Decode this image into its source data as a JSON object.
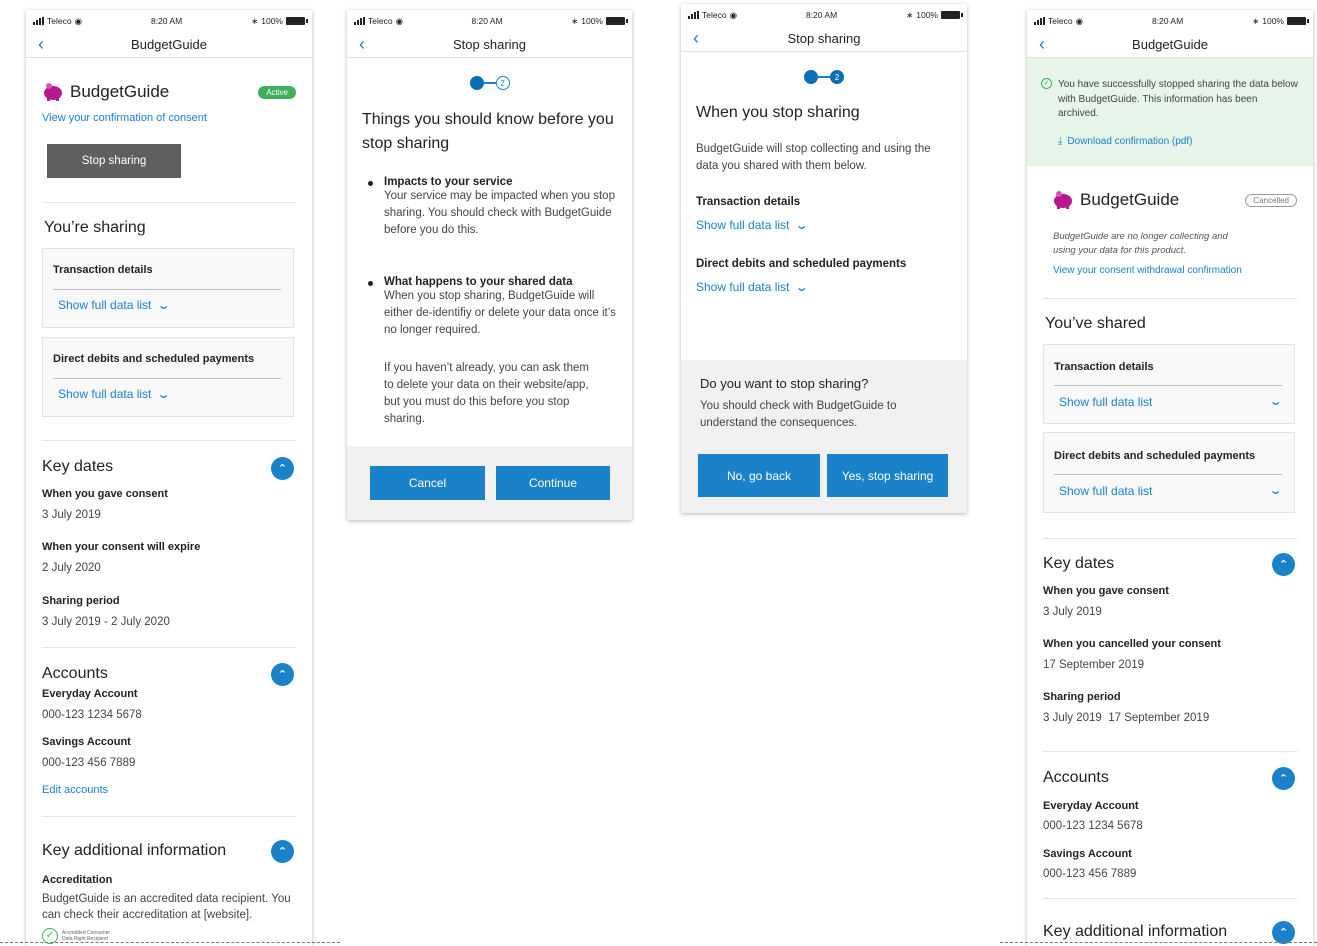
{
  "status": {
    "carrier": "Teleco",
    "time": "8:20 AM",
    "battery": "100%"
  },
  "brand": {
    "name": "BudgetGuide"
  },
  "colors": {
    "accent": "#1a82c8",
    "success": "#3fae5d",
    "banner": "#e6f4ea",
    "brand_pink": "#b5198f"
  },
  "screen1": {
    "nav_title": "BudgetGuide",
    "badge": "Active",
    "consent_link": "View your confirmation of consent",
    "stop_button": "Stop sharing",
    "sharing_title": "You’re sharing",
    "items": [
      {
        "title": "Transaction details",
        "link": "Show full data list"
      },
      {
        "title": "Direct debits and scheduled payments",
        "link": "Show full data list"
      }
    ],
    "key_dates": {
      "title": "Key dates",
      "rows": [
        {
          "label": "When you gave consent",
          "value": "3 July 2019"
        },
        {
          "label": "When your consent will expire",
          "value": "2 July 2020"
        },
        {
          "label": "Sharing period",
          "value": "3 July 2019 - 2 July 2020"
        }
      ]
    },
    "accounts": {
      "title": "Accounts",
      "rows": [
        {
          "label": "Everyday Account",
          "value": "000-123 1234 5678"
        },
        {
          "label": "Savings Account",
          "value": "000-123 456 7889"
        }
      ],
      "edit_link": "Edit accounts"
    },
    "additional": {
      "title": "Key additional information",
      "label": "Accreditation",
      "text": "BudgetGuide is an accredited data recipient. You can check their accreditation at [website].",
      "seal_text": "Accredited Consumer Data Right Recipient"
    }
  },
  "screen2": {
    "nav_title": "Stop sharing",
    "step1": "1",
    "step2": "2",
    "heading": "Things you should know before you stop sharing",
    "bullets": [
      {
        "title": "Impacts to your service",
        "text": "Your service may be impacted when you stop sharing. You should check with BudgetGuide before you do this."
      },
      {
        "title": "What happens to your shared data",
        "text": "When you stop sharing, BudgetGuide will either de-identifiy or delete your data once it’s no longer required."
      }
    ],
    "extra_text": "If you haven’t already, you can ask them to delete your data on their website/app, but you must do this before you stop sharing.",
    "cancel": "Cancel",
    "continue": "Continue"
  },
  "screen3": {
    "nav_title": "Stop sharing",
    "step1": "1",
    "step2": "2",
    "heading": "When you stop sharing",
    "text": "BudgetGuide will stop collecting and using the data you shared with them below.",
    "items": [
      {
        "title": "Transaction details",
        "link": "Show full data list"
      },
      {
        "title": "Direct debits and scheduled payments",
        "link": "Show full data list"
      }
    ],
    "question": "Do you want to stop sharing?",
    "question_text": "You should check with BudgetGuide to understand the consequences.",
    "no_button": "No, go back",
    "yes_button": "Yes, stop sharing"
  },
  "screen4": {
    "nav_title": "BudgetGuide",
    "banner_text": "You have successfully stopped sharing the data below with BudgetGuide. This information has been archived.",
    "download_link": "Download confirmation (pdf)",
    "badge": "Cancelled",
    "note": "BudgetGuide are no longer collecting and using your data for this product.",
    "withdrawal_link": "View your consent withdrawal confirmation",
    "shared_title": "You’ve shared",
    "items": [
      {
        "title": "Transaction details",
        "link": "Show full data list"
      },
      {
        "title": "Direct debits and scheduled payments",
        "link": "Show full data list"
      }
    ],
    "key_dates": {
      "title": "Key dates",
      "rows": [
        {
          "label": "When you gave consent",
          "value": "3 July 2019"
        },
        {
          "label": "When you cancelled your consent",
          "value": "17 September 2019"
        },
        {
          "label": "Sharing period",
          "value": "3 July 2019  17 September 2019"
        }
      ]
    },
    "accounts": {
      "title": "Accounts",
      "rows": [
        {
          "label": "Everyday Account",
          "value": "000-123 1234 5678"
        },
        {
          "label": "Savings Account",
          "value": "000-123 456 7889"
        }
      ]
    },
    "additional_title": "Key additional information"
  }
}
